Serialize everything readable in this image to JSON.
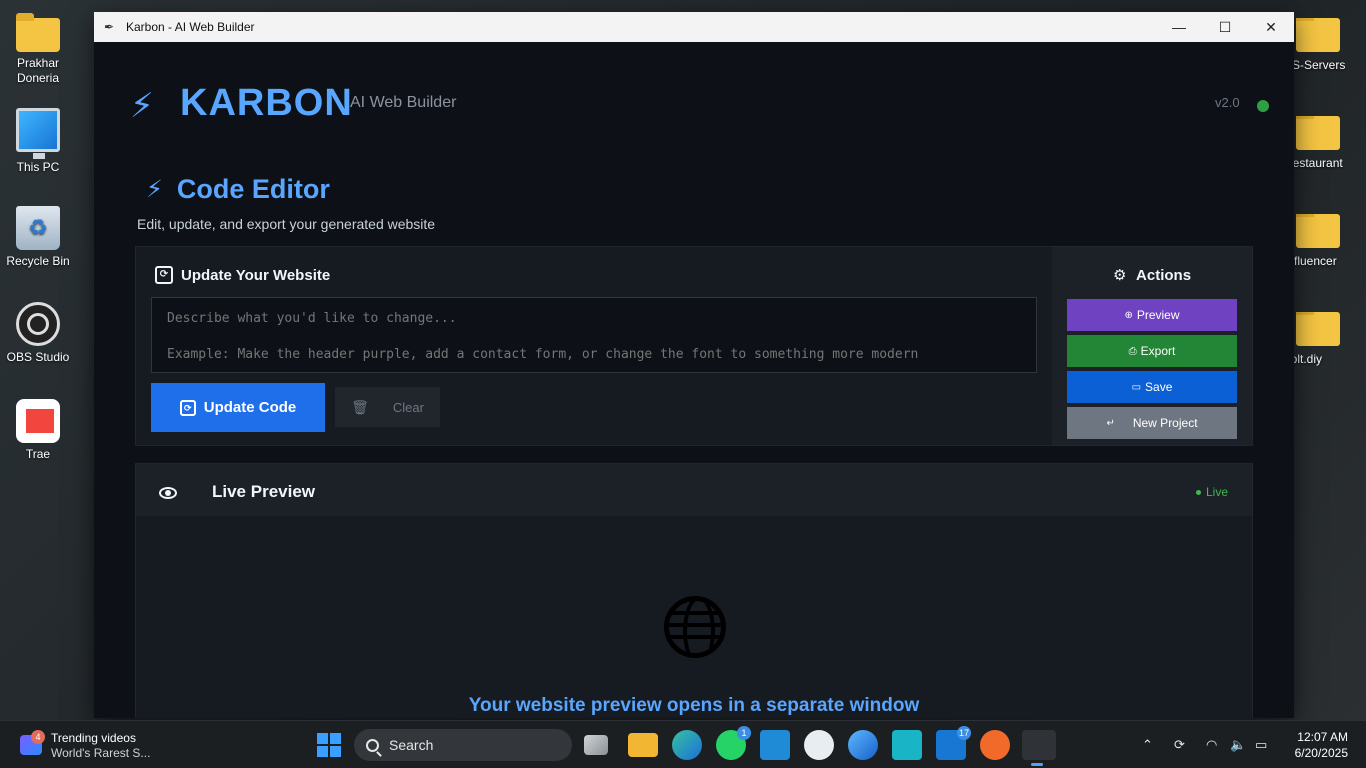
{
  "desktop": {
    "left_icons": [
      {
        "label": "Prakhar Doneria",
        "icon": "folder-icon"
      },
      {
        "label": "This PC",
        "icon": "computer-icon"
      },
      {
        "label": "Recycle Bin",
        "icon": "recycle-bin-icon"
      },
      {
        "label": "OBS Studio",
        "icon": "obs-icon"
      },
      {
        "label": "Trae",
        "icon": "trae-icon"
      }
    ],
    "right_icons": [
      {
        "label": "VS-Servers"
      },
      {
        "label": "Restaurant"
      },
      {
        "label": "Influencer"
      },
      {
        "label": "bolt.diy"
      }
    ]
  },
  "window": {
    "title": "Karbon - AI Web Builder",
    "minimize": "—",
    "maximize": "☐",
    "close": "✕"
  },
  "header": {
    "brand_icon": "⚡",
    "brand": "KARBON",
    "subtitle": "AI Web Builder",
    "version": "v2.0",
    "status_color": "#2ea043"
  },
  "editor": {
    "icon": "⚡",
    "title": "Code Editor",
    "subtitle": "Edit, update, and export your generated website",
    "update_heading": "Update Your Website",
    "textarea_placeholder": "Describe what you'd like to change...\n\nExample: Make the header purple, add a contact form, or change the font to something more modern",
    "update_button": "Update Code",
    "clear_button": "Clear",
    "clear_icon": "🗑"
  },
  "actions": {
    "heading": "Actions",
    "gear_icon": "⚙",
    "preview_icon": "⊕",
    "preview": "Preview",
    "export_icon": "⎙",
    "export": "Export",
    "save_icon": "▭",
    "save": "Save",
    "new_icon": "↵",
    "new_project": "New Project",
    "colors": {
      "preview": "#6f42c1",
      "export": "#238636",
      "save": "#0b60d6",
      "new": "#6e7681"
    }
  },
  "preview": {
    "title": "Live Preview",
    "live": "Live",
    "message": "Your website preview opens in a separate window"
  },
  "taskbar": {
    "widget_badge": "4",
    "widget_title": "Trending videos",
    "widget_subtitle": "World's Rarest S...",
    "search": "Search",
    "whatsapp_badge": "1",
    "outlook_badge": "17",
    "time": "12:07 AM",
    "date": "6/20/2025"
  }
}
